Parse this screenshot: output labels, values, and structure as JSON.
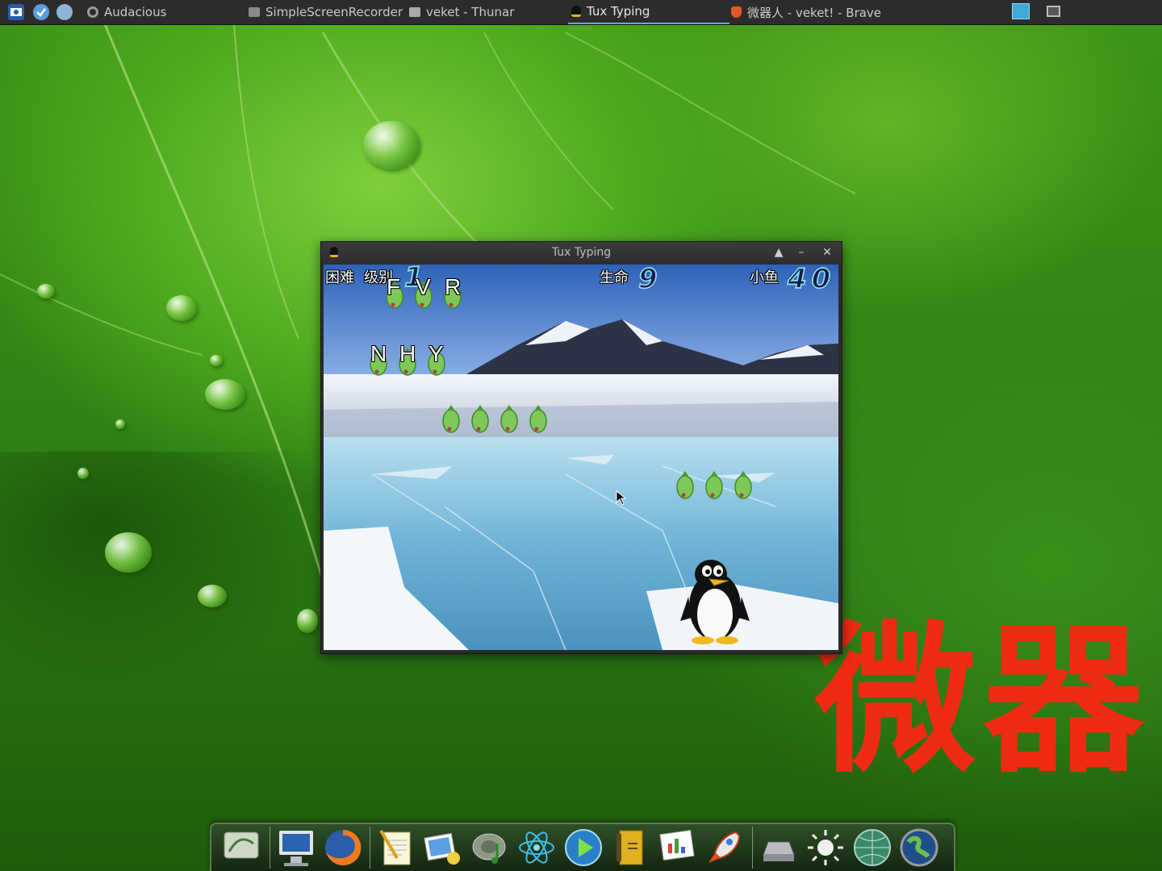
{
  "top_panel": {
    "launchers": [
      "screenshot-icon",
      "browser-check-icon",
      "network-icon"
    ],
    "tasks": [
      {
        "label": "Audacious",
        "icon": "audacious-icon",
        "active": false
      },
      {
        "label": "SimpleScreenRecorder",
        "icon": "window-icon",
        "active": false
      },
      {
        "label": "veket - Thunar",
        "icon": "folder-icon",
        "active": false
      },
      {
        "label": "Tux Typing",
        "icon": "tux-icon",
        "active": true
      },
      {
        "label": "微器人 - veket! - Brave",
        "icon": "brave-icon",
        "active": false
      }
    ],
    "tray": [
      "network-monitor-icon",
      "show-desktop-icon"
    ]
  },
  "window": {
    "title": "Tux Typing",
    "buttons": [
      "shade",
      "minimize",
      "close"
    ]
  },
  "game": {
    "difficulty": "困难",
    "level_label": "级别",
    "level_value": "1",
    "lives_label": "生命",
    "lives_value": "9",
    "fish_label": "小鱼",
    "fish_value": "40",
    "fish_rows": [
      {
        "letters": [
          "F",
          "V",
          "R"
        ]
      },
      {
        "letters": [
          "N",
          "H",
          "Y"
        ]
      },
      {
        "letters": [
          "",
          "",
          "",
          ""
        ]
      },
      {
        "letters": [
          "",
          "",
          ""
        ]
      }
    ]
  },
  "desktop": {
    "watermark": "微器"
  },
  "dock": {
    "items": [
      "desktop-settings-icon",
      "computer-icon",
      "firefox-icon",
      "text-editor-icon",
      "image-viewer-icon",
      "music-icon",
      "atom-icon",
      "media-player-icon",
      "address-book-icon",
      "spreadsheet-icon",
      "rocket-icon",
      "drive-icon",
      "brightness-icon",
      "globe-icon",
      "earth-icon"
    ]
  }
}
